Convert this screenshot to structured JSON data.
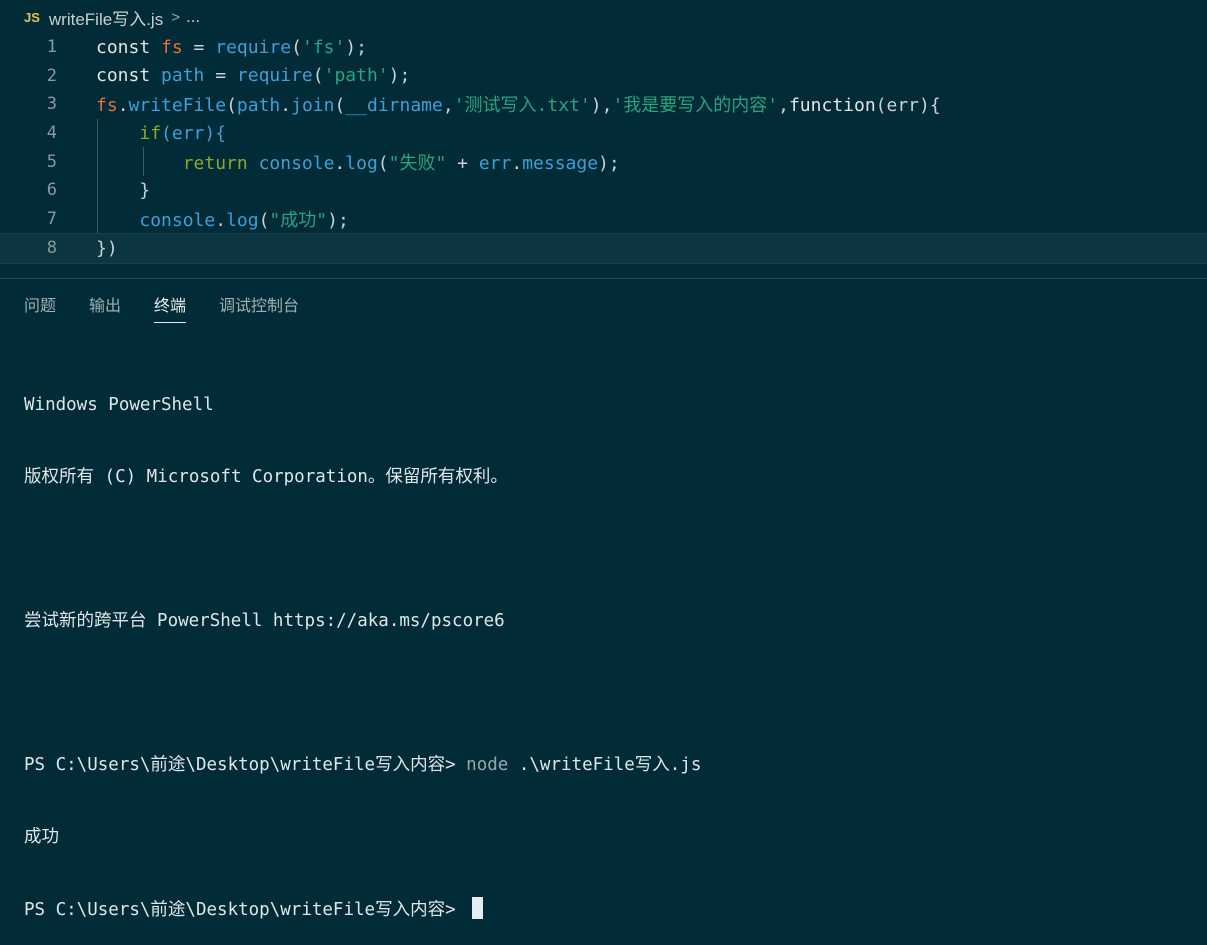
{
  "breadcrumb": {
    "file_icon": "JS",
    "file_name": "writeFile写入.js",
    "separator": ">",
    "more": "..."
  },
  "editor": {
    "line_numbers": [
      "1",
      "2",
      "3",
      "4",
      "5",
      "6",
      "7",
      "8"
    ],
    "lines": [
      [
        {
          "t": "const ",
          "c": "kw"
        },
        {
          "t": "fs",
          "c": "var"
        },
        {
          "t": " = ",
          "c": "op"
        },
        {
          "t": "require",
          "c": "fn"
        },
        {
          "t": "(",
          "c": "plain"
        },
        {
          "t": "'fs'",
          "c": "str"
        },
        {
          "t": ");",
          "c": "plain"
        }
      ],
      [
        {
          "t": "const ",
          "c": "kw"
        },
        {
          "t": "path",
          "c": "fn"
        },
        {
          "t": " = ",
          "c": "op"
        },
        {
          "t": "require",
          "c": "fn"
        },
        {
          "t": "(",
          "c": "plain"
        },
        {
          "t": "'path'",
          "c": "str"
        },
        {
          "t": ");",
          "c": "plain"
        }
      ],
      [
        {
          "t": "fs",
          "c": "var"
        },
        {
          "t": ".",
          "c": "plain"
        },
        {
          "t": "writeFile",
          "c": "fn"
        },
        {
          "t": "(",
          "c": "plain"
        },
        {
          "t": "path",
          "c": "fn"
        },
        {
          "t": ".",
          "c": "plain"
        },
        {
          "t": "join",
          "c": "fn"
        },
        {
          "t": "(",
          "c": "plain"
        },
        {
          "t": "__dirname",
          "c": "fn"
        },
        {
          "t": ",",
          "c": "plain"
        },
        {
          "t": "'测试写入.txt'",
          "c": "str"
        },
        {
          "t": "),",
          "c": "plain"
        },
        {
          "t": "'我是要写入的内容'",
          "c": "str"
        },
        {
          "t": ",",
          "c": "plain"
        },
        {
          "t": "function",
          "c": "kw"
        },
        {
          "t": "(err){",
          "c": "plain"
        }
      ],
      [
        {
          "t": "    ",
          "c": "plain"
        },
        {
          "t": "if",
          "c": "ret"
        },
        {
          "t": "(err){",
          "c": "fn"
        }
      ],
      [
        {
          "t": "        ",
          "c": "plain"
        },
        {
          "t": "return ",
          "c": "ret"
        },
        {
          "t": "console",
          "c": "fn"
        },
        {
          "t": ".",
          "c": "plain"
        },
        {
          "t": "log",
          "c": "fn"
        },
        {
          "t": "(",
          "c": "plain"
        },
        {
          "t": "\"失败\"",
          "c": "str"
        },
        {
          "t": " + ",
          "c": "op"
        },
        {
          "t": "err",
          "c": "fn"
        },
        {
          "t": ".",
          "c": "plain"
        },
        {
          "t": "message",
          "c": "fn"
        },
        {
          "t": ");",
          "c": "plain"
        }
      ],
      [
        {
          "t": "    }",
          "c": "plain"
        }
      ],
      [
        {
          "t": "    ",
          "c": "plain"
        },
        {
          "t": "console",
          "c": "fn"
        },
        {
          "t": ".",
          "c": "plain"
        },
        {
          "t": "log",
          "c": "fn"
        },
        {
          "t": "(",
          "c": "plain"
        },
        {
          "t": "\"成功\"",
          "c": "str"
        },
        {
          "t": ");",
          "c": "plain"
        }
      ],
      [
        {
          "t": "})",
          "c": "plain"
        }
      ]
    ]
  },
  "panel": {
    "tabs": [
      "问题",
      "输出",
      "终端",
      "调试控制台"
    ],
    "active_tab": "终端"
  },
  "terminal": {
    "line1": "Windows PowerShell",
    "line2": "版权所有 (C) Microsoft Corporation。保留所有权利。",
    "line3": "尝试新的跨平台 PowerShell https://aka.ms/pscore6",
    "prompt1": "PS C:\\Users\\前途\\Desktop\\writeFile写入内容> ",
    "command": "node",
    "command_arg": " .\\writeFile写入.js",
    "output": "成功",
    "prompt2": "PS C:\\Users\\前途\\Desktop\\writeFile写入内容> "
  },
  "colors": {
    "background": "#012b36",
    "keyword": "#e3e4e4",
    "variable": "#e2723b",
    "function": "#3f9fd8",
    "string": "#2aa37e",
    "control": "#8ea62d"
  }
}
